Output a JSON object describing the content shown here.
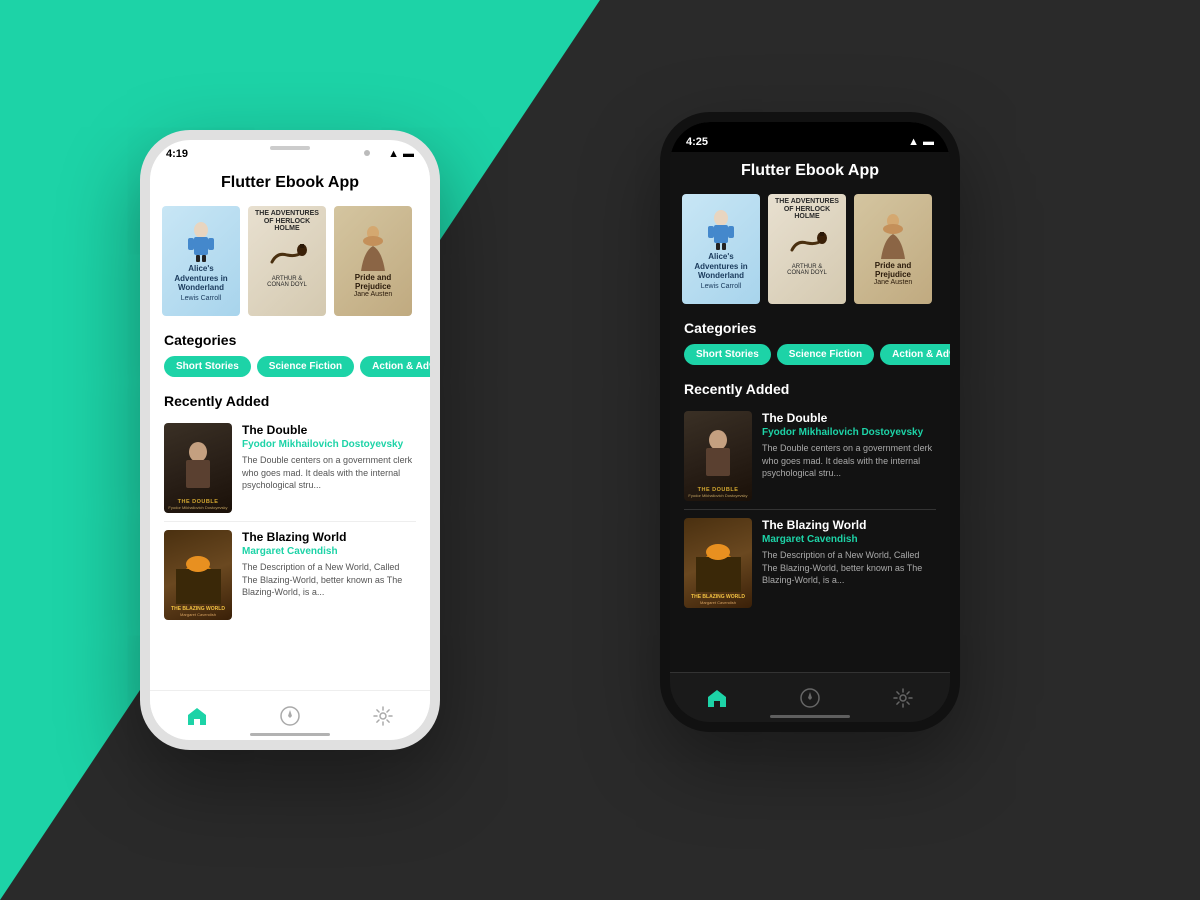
{
  "background": {
    "teal": "#1dd3a7",
    "dark": "#2a2a2a"
  },
  "phoneLight": {
    "time": "4:19",
    "theme": "light",
    "appTitle": "Flutter Ebook App",
    "books_carousel": [
      {
        "title": "Alice's Adventures in Wonderland",
        "author": "Lewis Carroll",
        "type": "alice"
      },
      {
        "title": "THE ADVENTURES OF HERLOCK HOLME",
        "author": "ARTHUR & CONAN DOYL",
        "type": "sherlock"
      },
      {
        "title": "Pride and Prejudice",
        "author": "Jane Austen",
        "type": "pride"
      }
    ],
    "categoriesLabel": "Categories",
    "categories": [
      "Short Stories",
      "Science Fiction",
      "Action & Adventur"
    ],
    "recentlyAddedLabel": "Recently Added",
    "recentlyAdded": [
      {
        "title": "The Double",
        "author": "Fyodor Mikhailovich Dostoyevsky",
        "description": "The Double centers on a government clerk who goes mad. It deals with the internal psychological stru...",
        "coverType": "double"
      },
      {
        "title": "The Blazing World",
        "author": "Margaret Cavendish",
        "description": "The Description of a New World, Called The Blazing-World, better known as The Blazing-World, is a...",
        "coverType": "blazing"
      }
    ],
    "navIcons": [
      "home",
      "compass",
      "settings"
    ]
  },
  "phoneDark": {
    "time": "4:25",
    "theme": "dark",
    "appTitle": "Flutter Ebook App",
    "books_carousel": [
      {
        "title": "Alice's Adventures in Wonderland",
        "author": "Lewis Carroll",
        "type": "alice"
      },
      {
        "title": "THE ADVENTURES OF HERLOCK HOLME",
        "author": "ARTHUR & CONAN DOYL",
        "type": "sherlock"
      },
      {
        "title": "Pride and Prejudice",
        "author": "Jane Austen",
        "type": "pride"
      }
    ],
    "categoriesLabel": "Categories",
    "categories": [
      "Short Stories",
      "Science Fiction",
      "Action & Adventur"
    ],
    "recentlyAddedLabel": "Recently Added",
    "recentlyAdded": [
      {
        "title": "The Double",
        "author": "Fyodor Mikhailovich Dostoyevsky",
        "description": "The Double centers on a government clerk who goes mad. It deals with the internal psychological stru...",
        "coverType": "double"
      },
      {
        "title": "The Blazing World",
        "author": "Margaret Cavendish",
        "description": "The Description of a New World, Called The Blazing-World, better known as The Blazing-World, is a...",
        "coverType": "blazing"
      }
    ],
    "navIcons": [
      "home",
      "compass",
      "settings"
    ]
  },
  "chips": {
    "color": "#1dd3a7",
    "label0": "Short Stories",
    "label1": "Science Fiction",
    "label2": "Action & Adventur"
  }
}
